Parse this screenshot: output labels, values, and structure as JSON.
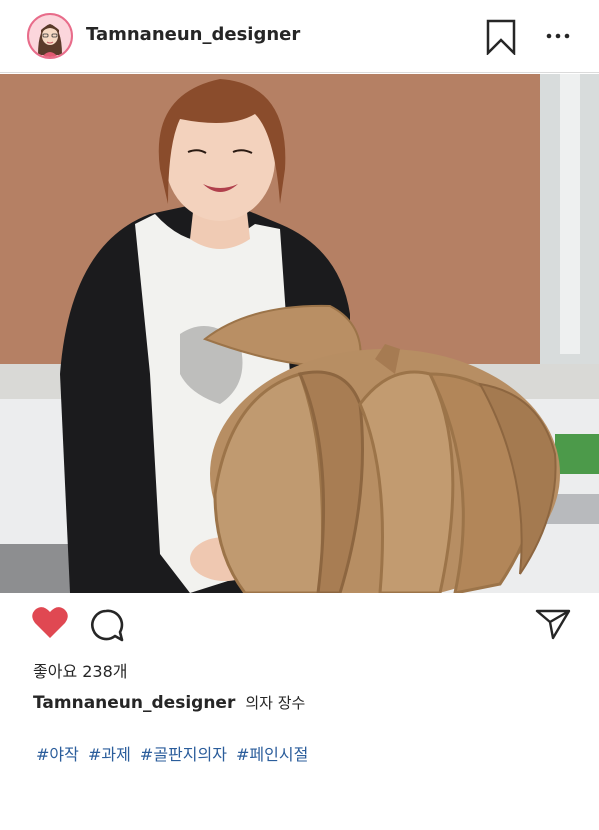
{
  "post": {
    "username": "Tamnaneun_designer",
    "likes_text": "좋아요 238개",
    "caption_text": "의자 장수",
    "hashtags": [
      "#야작",
      "#과제",
      "#골판지의자",
      "#페인시절"
    ]
  },
  "icons": {
    "avatar": "avatar-illustration",
    "bookmark": "bookmark-icon",
    "more": "more-dots-icon",
    "like": "heart-icon",
    "comment": "comment-bubble-icon",
    "share": "send-paper-plane-icon"
  },
  "colors": {
    "like_active": "#e04852",
    "hashtag": "#2b5d9b",
    "avatar_ring": "#e86c8a"
  }
}
